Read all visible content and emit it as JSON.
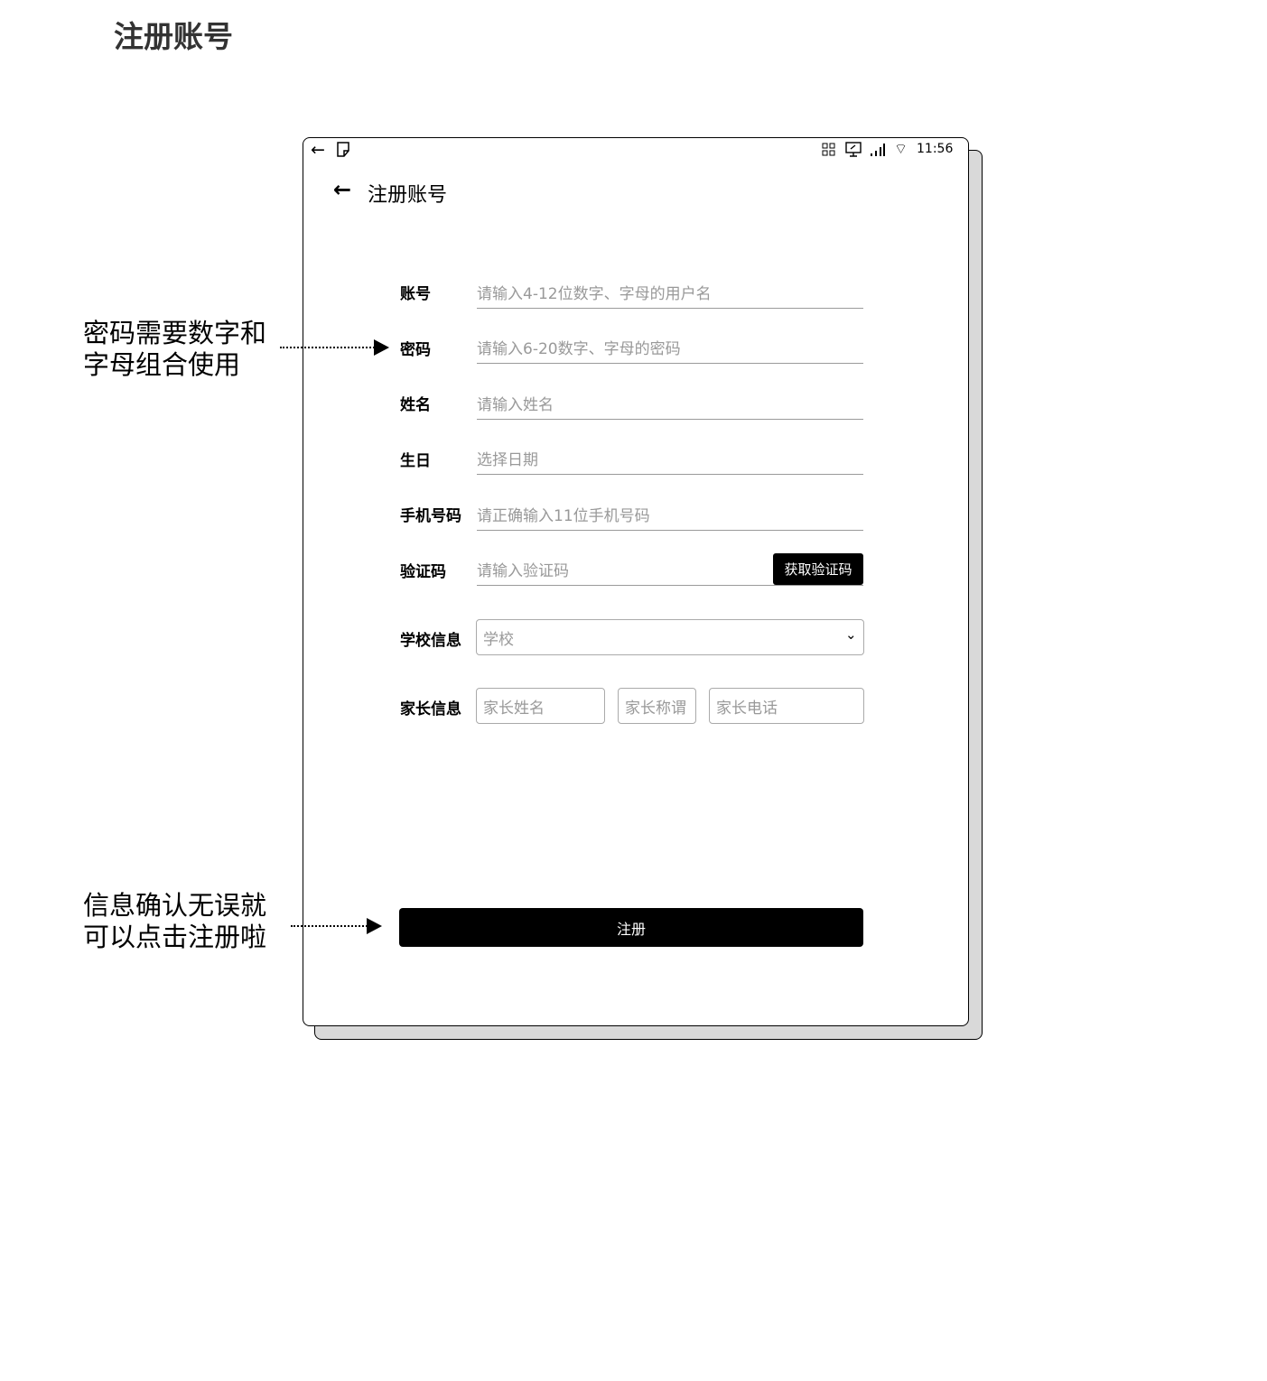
{
  "page_title": "注册账号",
  "status_bar": {
    "time": "11:56"
  },
  "header": {
    "title": "注册账号"
  },
  "form": {
    "account": {
      "label": "账号",
      "placeholder": "请输入4-12位数字、字母的用户名"
    },
    "password": {
      "label": "密码",
      "placeholder": "请输入6-20数字、字母的密码"
    },
    "name": {
      "label": "姓名",
      "placeholder": "请输入姓名"
    },
    "birthday": {
      "label": "生日",
      "placeholder": "选择日期"
    },
    "phone": {
      "label": "手机号码",
      "placeholder": "请正确输入11位手机号码"
    },
    "code": {
      "label": "验证码",
      "placeholder": "请输入验证码",
      "button": "获取验证码"
    },
    "school": {
      "label": "学校信息",
      "placeholder": "学校"
    },
    "parent": {
      "label": "家长信息",
      "name_placeholder": "家长姓名",
      "relation_placeholder": "家长称谓",
      "phone_placeholder": "家长电话"
    },
    "submit": "注册"
  },
  "annotations": {
    "password_note": [
      "密码需要数字和",
      "字母组合使用"
    ],
    "submit_note": [
      "信息确认无误就",
      "可以点击注册啦"
    ]
  }
}
